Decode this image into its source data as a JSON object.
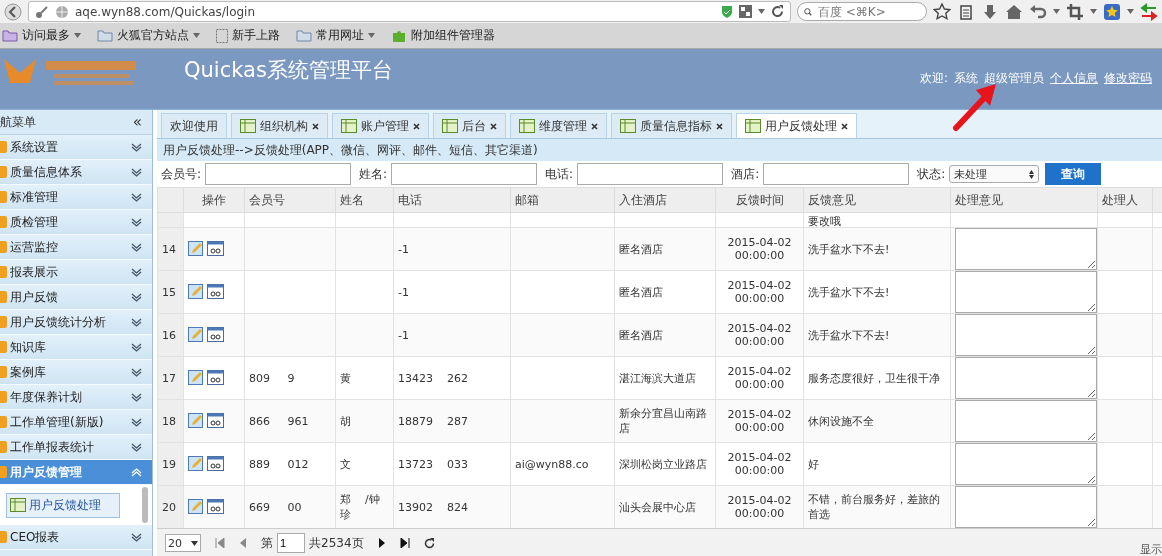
{
  "browser": {
    "url": "aqe.wyn88.com/Quickas/login",
    "search_placeholder": "百度 <⌘K>",
    "bookmarks": [
      {
        "label": "访问最多",
        "kind": "smart",
        "dropdown": true
      },
      {
        "label": "火狐官方站点",
        "kind": "folder",
        "dropdown": true
      },
      {
        "label": "新手上路",
        "kind": "page",
        "dropdown": false
      },
      {
        "label": "常用网址",
        "kind": "folder",
        "dropdown": true
      },
      {
        "label": "附加组件管理器",
        "kind": "addon",
        "dropdown": false
      }
    ]
  },
  "header": {
    "title": "Quickas系统管理平台",
    "welcome": "欢迎:",
    "user": "系统",
    "role": "超级管理员",
    "links": [
      "个人信息",
      "修改密码"
    ]
  },
  "sidebar": {
    "title": "航菜单",
    "collapse": "«",
    "items": [
      {
        "label": "系统设置",
        "expanded": false,
        "selected": false
      },
      {
        "label": "质量信息体系",
        "expanded": false,
        "selected": false
      },
      {
        "label": "标准管理",
        "expanded": false,
        "selected": false
      },
      {
        "label": "质检管理",
        "expanded": false,
        "selected": false
      },
      {
        "label": "运营监控",
        "expanded": false,
        "selected": false
      },
      {
        "label": "报表展示",
        "expanded": false,
        "selected": false
      },
      {
        "label": "用户反馈",
        "expanded": false,
        "selected": false
      },
      {
        "label": "用户反馈统计分析",
        "expanded": false,
        "selected": false
      },
      {
        "label": "知识库",
        "expanded": false,
        "selected": false
      },
      {
        "label": "案例库",
        "expanded": false,
        "selected": false
      },
      {
        "label": "年度保养计划",
        "expanded": false,
        "selected": false
      },
      {
        "label": "工作单管理(新版)",
        "expanded": false,
        "selected": false
      },
      {
        "label": "工作单报表统计",
        "expanded": false,
        "selected": false
      },
      {
        "label": "用户反馈管理",
        "expanded": true,
        "selected": true,
        "children": [
          {
            "label": "用户反馈处理",
            "selected": true
          }
        ]
      },
      {
        "label": "CEO报表",
        "expanded": false,
        "selected": false
      }
    ]
  },
  "tabs": [
    {
      "label": "欢迎使用",
      "closable": false,
      "selected": false
    },
    {
      "label": "组织机构",
      "closable": true,
      "selected": false
    },
    {
      "label": "账户管理",
      "closable": true,
      "selected": false
    },
    {
      "label": "后台",
      "closable": true,
      "selected": false
    },
    {
      "label": "维度管理",
      "closable": true,
      "selected": false
    },
    {
      "label": "质量信息指标",
      "closable": true,
      "selected": false
    },
    {
      "label": "用户反馈处理",
      "closable": true,
      "selected": true
    }
  ],
  "breadcrumb": "用户反馈处理-->反馈处理(APP、微信、网评、邮件、短信、其它渠道)",
  "filters": [
    {
      "label": "会员号:"
    },
    {
      "label": "姓名:"
    },
    {
      "label": "电话:"
    },
    {
      "label": "酒店:"
    }
  ],
  "status_filter": {
    "label": "状态:",
    "value": "未处理"
  },
  "query_button": "查询",
  "table": {
    "columns": [
      "",
      "操作",
      "会员号",
      "姓名",
      "电话",
      "邮箱",
      "入住酒店",
      "反馈时间",
      "反馈意见",
      "处理意见",
      "处理人"
    ],
    "partial_row": {
      "feedback": "要改哦"
    },
    "rows": [
      {
        "no": "14",
        "member": "",
        "name": "",
        "phone": "-1",
        "email": "",
        "hotel": "匿名酒店",
        "time": "2015-04-02 00:00:00",
        "feedback": "洗手盆水下不去!"
      },
      {
        "no": "15",
        "member": "",
        "name": "",
        "phone": "-1",
        "email": "",
        "hotel": "匿名酒店",
        "time": "2015-04-02 00:00:00",
        "feedback": "洗手盆水下不去!"
      },
      {
        "no": "16",
        "member": "",
        "name": "",
        "phone": "-1",
        "email": "",
        "hotel": "匿名酒店",
        "time": "2015-04-02 00:00:00",
        "feedback": "洗手盆水下不去!"
      },
      {
        "no": "17",
        "member": "809     9",
        "name": "黄",
        "phone": "13423    262",
        "email": "",
        "hotel": "湛江海滨大道店",
        "time": "2015-04-02 00:00:00",
        "feedback": "服务态度很好，卫生很干净"
      },
      {
        "no": "18",
        "member": "866     961",
        "name": "胡",
        "phone": "18879    287",
        "email": "",
        "hotel": "新余分宜昌山南路店",
        "time": "2015-04-02 00:00:00",
        "feedback": "休闲设施不全"
      },
      {
        "no": "19",
        "member": "889     012",
        "name": "文",
        "phone": "13723    033",
        "email": "ai@wyn88.co",
        "hotel": "深圳松岗立业路店",
        "time": "2015-04-02 00:00:00",
        "feedback": "好"
      },
      {
        "no": "20",
        "member": "669     00",
        "name": "郑    /钟珍",
        "phone": "13902    824",
        "email": "",
        "hotel": "汕头会展中心店",
        "time": "2015-04-02 00:00:00",
        "feedback": "不错，前台服务好，差旅的首选"
      }
    ]
  },
  "pager": {
    "page_size": "20",
    "page_prefix": "第",
    "page": "1",
    "total": "共2534页",
    "display": "显示"
  }
}
